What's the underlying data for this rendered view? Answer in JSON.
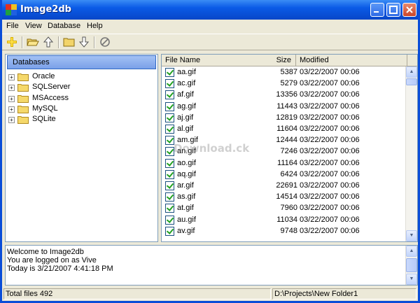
{
  "window": {
    "title": "Image2db"
  },
  "menu": {
    "items": [
      "File",
      "View",
      "Database",
      "Help"
    ]
  },
  "toolbar": {
    "icons": [
      "add-icon",
      "open-folder-icon",
      "up-arrow-icon",
      "folder-icon",
      "down-arrow-icon",
      "cancel-icon"
    ]
  },
  "databases": {
    "header": "Databases",
    "items": [
      "Oracle",
      "SQLServer",
      "MSAccess",
      "MySQL",
      "SQLite"
    ]
  },
  "files": {
    "columns": {
      "name": "File Name",
      "size": "Size",
      "modified": "Modified"
    },
    "rows": [
      {
        "name": "aa.gif",
        "size": "5387",
        "modified": "03/22/2007  00:06"
      },
      {
        "name": "ac.gif",
        "size": "5279",
        "modified": "03/22/2007  00:06"
      },
      {
        "name": "af.gif",
        "size": "13356",
        "modified": "03/22/2007  00:06"
      },
      {
        "name": "ag.gif",
        "size": "11443",
        "modified": "03/22/2007  00:06"
      },
      {
        "name": "aj.gif",
        "size": "12819",
        "modified": "03/22/2007  00:06"
      },
      {
        "name": "al.gif",
        "size": "11604",
        "modified": "03/22/2007  00:06"
      },
      {
        "name": "am.gif",
        "size": "12444",
        "modified": "03/22/2007  00:06"
      },
      {
        "name": "an.gif",
        "size": "7246",
        "modified": "03/22/2007  00:06"
      },
      {
        "name": "ao.gif",
        "size": "11164",
        "modified": "03/22/2007  00:06"
      },
      {
        "name": "aq.gif",
        "size": "6424",
        "modified": "03/22/2007  00:06"
      },
      {
        "name": "ar.gif",
        "size": "22691",
        "modified": "03/22/2007  00:06"
      },
      {
        "name": "as.gif",
        "size": "14514",
        "modified": "03/22/2007  00:06"
      },
      {
        "name": "at.gif",
        "size": "7960",
        "modified": "03/22/2007  00:06"
      },
      {
        "name": "au.gif",
        "size": "11034",
        "modified": "03/22/2007  00:06"
      },
      {
        "name": "av.gif",
        "size": "9748",
        "modified": "03/22/2007  00:06"
      }
    ]
  },
  "log": {
    "lines": [
      "Welcome to Image2db",
      "You are logged on as Vive",
      "Today is 3/21/2007 4:41:18 PM"
    ]
  },
  "status": {
    "total": "Total files 492",
    "path": "D:\\Projects\\New Folder1"
  },
  "watermark": "Download.ck",
  "colors": {
    "titlebar": "#0a5ae6",
    "selection_header": "#7aa0e8",
    "check": "#21a121"
  }
}
